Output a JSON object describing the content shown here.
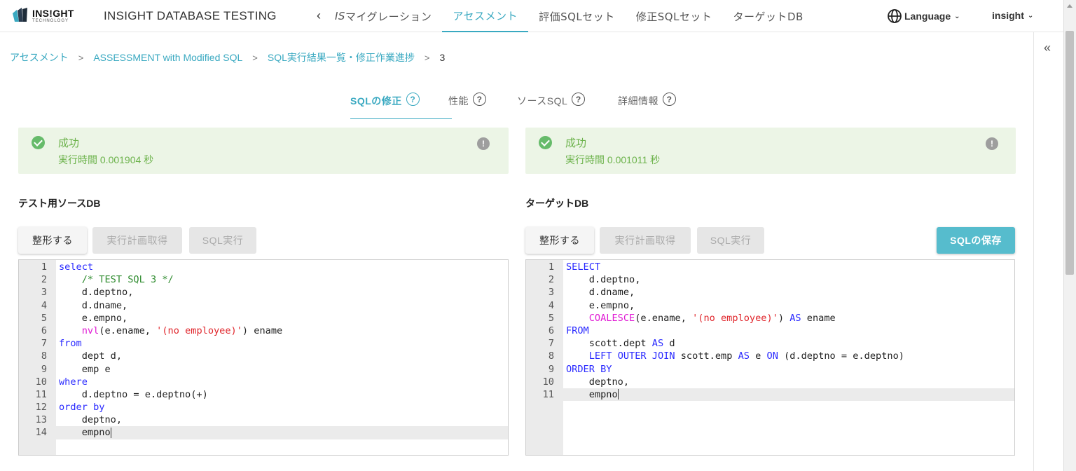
{
  "header": {
    "logo_text": "INS!GHT",
    "logo_sub": "TECHNOLOGY",
    "app_title": "INSIGHT DATABASE TESTING",
    "nav": [
      {
        "label": "ISマイグレーション",
        "italic_prefix": "IS",
        "rest": "マイグレーション",
        "active": false
      },
      {
        "label": "アセスメント",
        "active": true
      },
      {
        "label": "評価SQLセット",
        "active": false
      },
      {
        "label": "修正SQLセット",
        "active": false
      },
      {
        "label": "ターゲットDB",
        "active": false
      }
    ],
    "language_label": "Language",
    "user_label": "insight"
  },
  "breadcrumb": {
    "items": [
      "アセスメント",
      "ASSESSMENT with Modified SQL",
      "SQL実行結果一覧・修正作業進捗"
    ],
    "current": "3"
  },
  "subtabs": [
    {
      "label": "SQLの修正",
      "active": true
    },
    {
      "label": "性能",
      "active": false
    },
    {
      "label": "ソースSQL",
      "active": false
    },
    {
      "label": "詳細情報",
      "active": false
    }
  ],
  "left": {
    "status_title": "成功",
    "status_time": "実行時間 0.001904 秒",
    "db_title": "テスト用ソースDB",
    "buttons": {
      "format": "整形する",
      "plan": "実行計画取得",
      "run": "SQL実行"
    },
    "code": [
      "select",
      "    /* TEST SQL 3 */",
      "    d.deptno,",
      "    d.dname,",
      "    e.empno,",
      "    nvl(e.ename, '(no employee)') ename",
      "from",
      "    dept d,",
      "    emp e",
      "where",
      "    d.deptno = e.deptno(+)",
      "order by",
      "    deptno,",
      "    empno"
    ]
  },
  "right": {
    "status_title": "成功",
    "status_time": "実行時間 0.001011 秒",
    "db_title": "ターゲットDB",
    "buttons": {
      "format": "整形する",
      "plan": "実行計画取得",
      "run": "SQL実行",
      "save": "SQLの保存"
    },
    "code": [
      "SELECT",
      "    d.deptno,",
      "    d.dname,",
      "    e.empno,",
      "    COALESCE(e.ename, '(no employee)') AS ename",
      "FROM",
      "    scott.dept AS d",
      "    LEFT OUTER JOIN scott.emp AS e ON (d.deptno = e.deptno)",
      "ORDER BY",
      "    deptno,",
      "    empno"
    ]
  },
  "icons": {
    "collapse": "double-chevron-left-icon",
    "check": "check-circle-icon",
    "info": "exclamation-circle-icon"
  },
  "colors": {
    "accent": "#3aa9c1",
    "success_bg": "#ecf5e6",
    "success_text": "#6bb24a",
    "save_button": "#56bccd"
  }
}
